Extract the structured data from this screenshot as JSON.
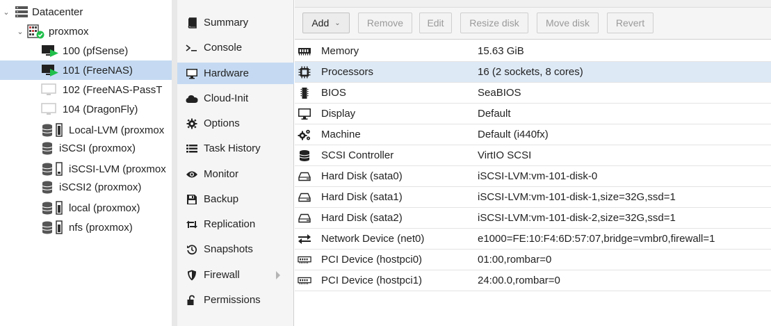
{
  "tree": {
    "datacenter": {
      "label": "Datacenter",
      "icon": "server-rack-icon"
    },
    "node": {
      "label": "proxmox",
      "icon": "node-online-icon"
    },
    "guests": [
      {
        "label": "100 (pfSense)",
        "icon": "vm-running-icon",
        "state": "running"
      },
      {
        "label": "101 (FreeNAS)",
        "icon": "vm-running-icon",
        "state": "running",
        "selected": true
      },
      {
        "label": "102 (FreeNAS-PassT",
        "icon": "vm-stopped-icon",
        "state": "stopped"
      },
      {
        "label": "104 (DragonFly)",
        "icon": "vm-stopped-icon",
        "state": "stopped"
      }
    ],
    "storages": [
      {
        "label": "Local-LVM (proxmox",
        "icon": "storage-usage-icon"
      },
      {
        "label": "iSCSI (proxmox)",
        "icon": "storage-icon"
      },
      {
        "label": "iSCSI-LVM (proxmox",
        "icon": "storage-usage-icon"
      },
      {
        "label": "iSCSI2 (proxmox)",
        "icon": "storage-icon"
      },
      {
        "label": "local (proxmox)",
        "icon": "storage-usage-icon"
      },
      {
        "label": "nfs (proxmox)",
        "icon": "storage-usage-icon"
      }
    ]
  },
  "menu": {
    "items": [
      {
        "label": "Summary",
        "icon": "book-icon"
      },
      {
        "label": "Console",
        "icon": "terminal-icon"
      },
      {
        "label": "Hardware",
        "icon": "desktop-icon",
        "active": true
      },
      {
        "label": "Cloud-Init",
        "icon": "cloud-icon"
      },
      {
        "label": "Options",
        "icon": "gear-icon"
      },
      {
        "label": "Task History",
        "icon": "list-icon"
      },
      {
        "label": "Monitor",
        "icon": "eye-icon"
      },
      {
        "label": "Backup",
        "icon": "floppy-icon"
      },
      {
        "label": "Replication",
        "icon": "retweet-icon"
      },
      {
        "label": "Snapshots",
        "icon": "history-icon"
      },
      {
        "label": "Firewall",
        "icon": "shield-icon",
        "expandable": true
      },
      {
        "label": "Permissions",
        "icon": "unlock-icon"
      }
    ]
  },
  "toolbar": {
    "add": "Add",
    "remove": "Remove",
    "edit": "Edit",
    "resize": "Resize disk",
    "move": "Move disk",
    "revert": "Revert"
  },
  "hardware": [
    {
      "name": "Memory",
      "value": "15.63 GiB",
      "icon": "memory-icon"
    },
    {
      "name": "Processors",
      "value": "16 (2 sockets, 8 cores)",
      "icon": "cpu-icon",
      "selected": true
    },
    {
      "name": "BIOS",
      "value": "SeaBIOS",
      "icon": "microchip-icon"
    },
    {
      "name": "Display",
      "value": "Default",
      "icon": "monitor-icon"
    },
    {
      "name": "Machine",
      "value": "Default (i440fx)",
      "icon": "cogs-icon"
    },
    {
      "name": "SCSI Controller",
      "value": "VirtIO SCSI",
      "icon": "database-icon"
    },
    {
      "name": "Hard Disk (sata0)",
      "value": "iSCSI-LVM:vm-101-disk-0",
      "icon": "hdd-icon"
    },
    {
      "name": "Hard Disk (sata1)",
      "value": "iSCSI-LVM:vm-101-disk-1,size=32G,ssd=1",
      "icon": "hdd-icon"
    },
    {
      "name": "Hard Disk (sata2)",
      "value": "iSCSI-LVM:vm-101-disk-2,size=32G,ssd=1",
      "icon": "hdd-icon"
    },
    {
      "name": "Network Device (net0)",
      "value": "e1000=FE:10:F4:6D:57:07,bridge=vmbr0,firewall=1",
      "icon": "exchange-icon"
    },
    {
      "name": "PCI Device (hostpci0)",
      "value": "01:00,rombar=0",
      "icon": "pci-card-icon"
    },
    {
      "name": "PCI Device (hostpci1)",
      "value": "24:00.0,rombar=0",
      "icon": "pci-card-icon"
    }
  ],
  "colors": {
    "selection": "#c5daf2",
    "row_selected": "#dde9f5",
    "running_green": "#21bf4b"
  }
}
